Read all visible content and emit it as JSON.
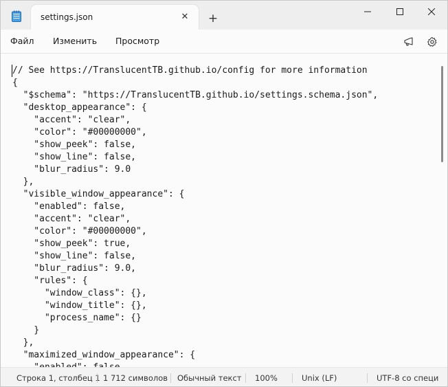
{
  "window": {
    "tab_title": "settings.json",
    "new_tab": "+",
    "tab_close": "✕"
  },
  "menu": {
    "file": "Файл",
    "edit": "Изменить",
    "view": "Просмотр"
  },
  "editor": {
    "lines": [
      "// See https://TranslucentTB.github.io/config for more information",
      "{",
      "  \"$schema\": \"https://TranslucentTB.github.io/settings.schema.json\",",
      "  \"desktop_appearance\": {",
      "    \"accent\": \"clear\",",
      "    \"color\": \"#00000000\",",
      "    \"show_peek\": false,",
      "    \"show_line\": false,",
      "    \"blur_radius\": 9.0",
      "  },",
      "  \"visible_window_appearance\": {",
      "    \"enabled\": false,",
      "    \"accent\": \"clear\",",
      "    \"color\": \"#00000000\",",
      "    \"show_peek\": true,",
      "    \"show_line\": false,",
      "    \"blur_radius\": 9.0,",
      "    \"rules\": {",
      "      \"window_class\": {},",
      "      \"window_title\": {},",
      "      \"process_name\": {}",
      "    }",
      "  },",
      "  \"maximized_window_appearance\": {",
      "    \"enabled\": false,"
    ]
  },
  "status": {
    "position": "Строка 1, столбец 1",
    "chars": "1 712 символов",
    "format": "Обычный текст",
    "zoom": "100%",
    "line_ending": "Unix (LF)",
    "encoding": "UTF-8 со специ"
  }
}
